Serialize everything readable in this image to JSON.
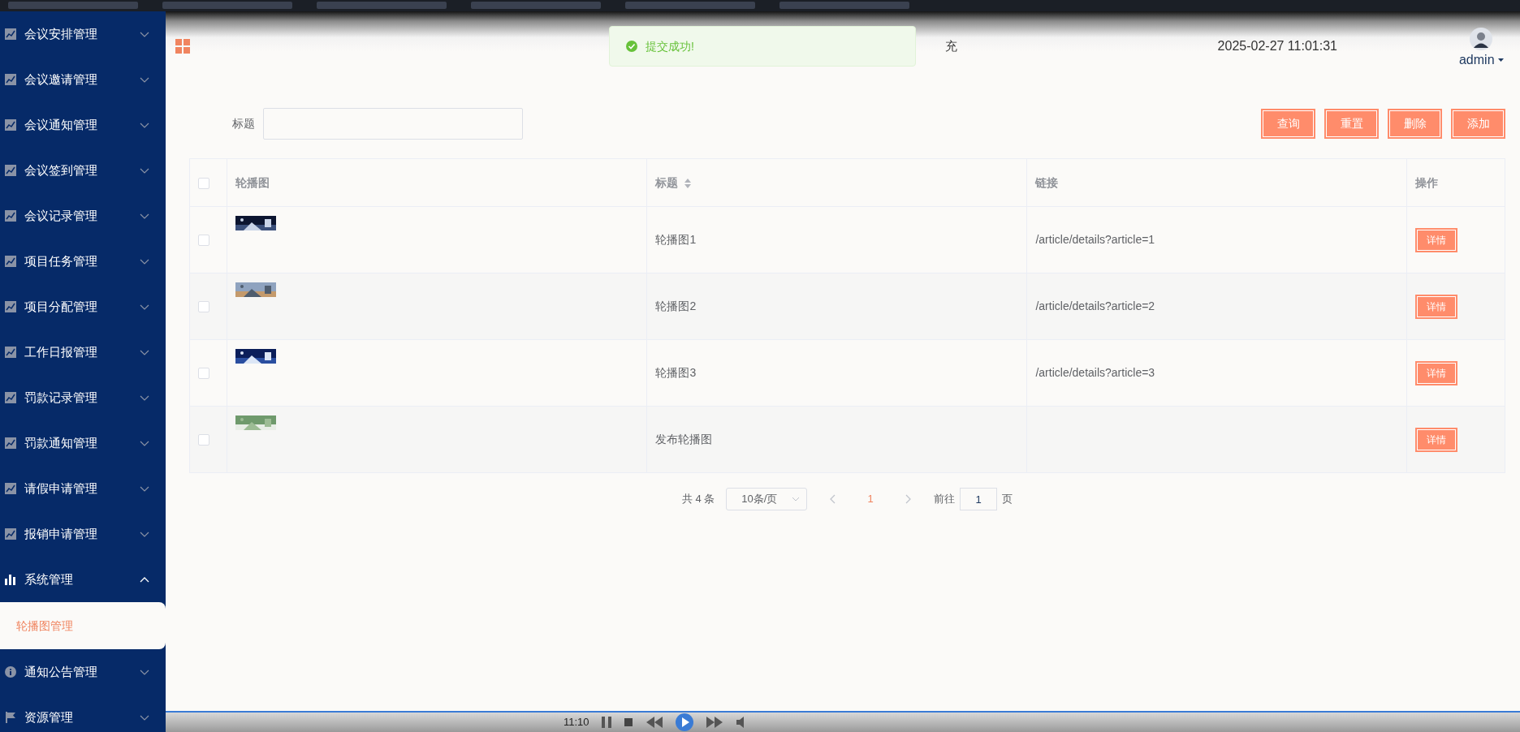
{
  "sidebar": {
    "items": [
      {
        "label": "会议安排管理",
        "kind": "chart",
        "expanded": false
      },
      {
        "label": "会议邀请管理",
        "kind": "chart",
        "expanded": false
      },
      {
        "label": "会议通知管理",
        "kind": "chart",
        "expanded": false
      },
      {
        "label": "会议签到管理",
        "kind": "chart",
        "expanded": false
      },
      {
        "label": "会议记录管理",
        "kind": "chart",
        "expanded": false
      },
      {
        "label": "项目任务管理",
        "kind": "chart",
        "expanded": false
      },
      {
        "label": "项目分配管理",
        "kind": "chart",
        "expanded": false
      },
      {
        "label": "工作日报管理",
        "kind": "chart",
        "expanded": false
      },
      {
        "label": "罚款记录管理",
        "kind": "chart",
        "expanded": false
      },
      {
        "label": "罚款通知管理",
        "kind": "chart",
        "expanded": false
      },
      {
        "label": "请假申请管理",
        "kind": "chart",
        "expanded": false
      },
      {
        "label": "报销申请管理",
        "kind": "chart",
        "expanded": false
      },
      {
        "label": "系统管理",
        "kind": "bars",
        "expanded": true,
        "children": [
          {
            "label": "轮播图管理",
            "selected": true
          }
        ]
      },
      {
        "label": "通知公告管理",
        "kind": "info",
        "expanded": false
      },
      {
        "label": "资源管理",
        "kind": "flag",
        "expanded": false
      }
    ]
  },
  "header": {
    "title_fragment": "充",
    "datetime": "2025-02-27 11:01:31",
    "user": "admin"
  },
  "toast": {
    "kind": "success",
    "message": "提交成功!"
  },
  "search": {
    "label": "标题"
  },
  "buttons": [
    "查询",
    "重置",
    "删除",
    "添加"
  ],
  "table": {
    "columns": [
      {
        "label": "轮播图",
        "kind": "plain"
      },
      {
        "label": "标题",
        "kind": "sortable"
      },
      {
        "label": "链接",
        "kind": "plain"
      },
      {
        "label": "操作",
        "kind": "plain"
      }
    ],
    "header_checked": false,
    "rows": [
      {
        "checked": false,
        "title": "轮播图1",
        "link": "/article/details?article=1",
        "action": "详情"
      },
      {
        "checked": false,
        "title": "轮播图2",
        "link": "/article/details?article=2",
        "action": "详情"
      },
      {
        "checked": false,
        "title": "轮播图3",
        "link": "/article/details?article=3",
        "action": "详情"
      },
      {
        "checked": false,
        "title": "发布轮播图",
        "action": "详情"
      }
    ]
  },
  "pagination": {
    "total": "共 4 条",
    "page_size": "10条/页",
    "pages": [
      {
        "label": "1",
        "selected": true
      }
    ],
    "goto_label": "前往",
    "goto_value": "1",
    "goto_unit": "页"
  },
  "player": {
    "time": "11:10"
  }
}
